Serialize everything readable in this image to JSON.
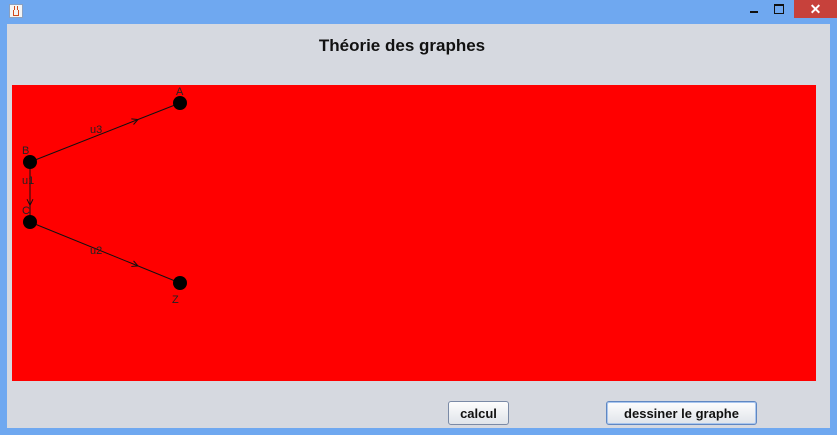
{
  "window": {
    "minimize_glyph": "",
    "maximize_glyph": "",
    "close_glyph": "✕"
  },
  "page": {
    "title": "Théorie des graphes"
  },
  "graph": {
    "background_color": "#ff0000",
    "nodes": [
      {
        "id": "A",
        "label": "A"
      },
      {
        "id": "B",
        "label": "B"
      },
      {
        "id": "C",
        "label": "C"
      },
      {
        "id": "Z",
        "label": "Z"
      }
    ],
    "edges": [
      {
        "id": "u3",
        "label": "u3",
        "from": "B",
        "to": "A"
      },
      {
        "id": "u1",
        "label": "u1",
        "from": "B",
        "to": "C"
      },
      {
        "id": "u2",
        "label": "u2",
        "from": "C",
        "to": "Z"
      }
    ]
  },
  "buttons": {
    "calcul": "calcul",
    "draw": "dessiner le graphe"
  }
}
